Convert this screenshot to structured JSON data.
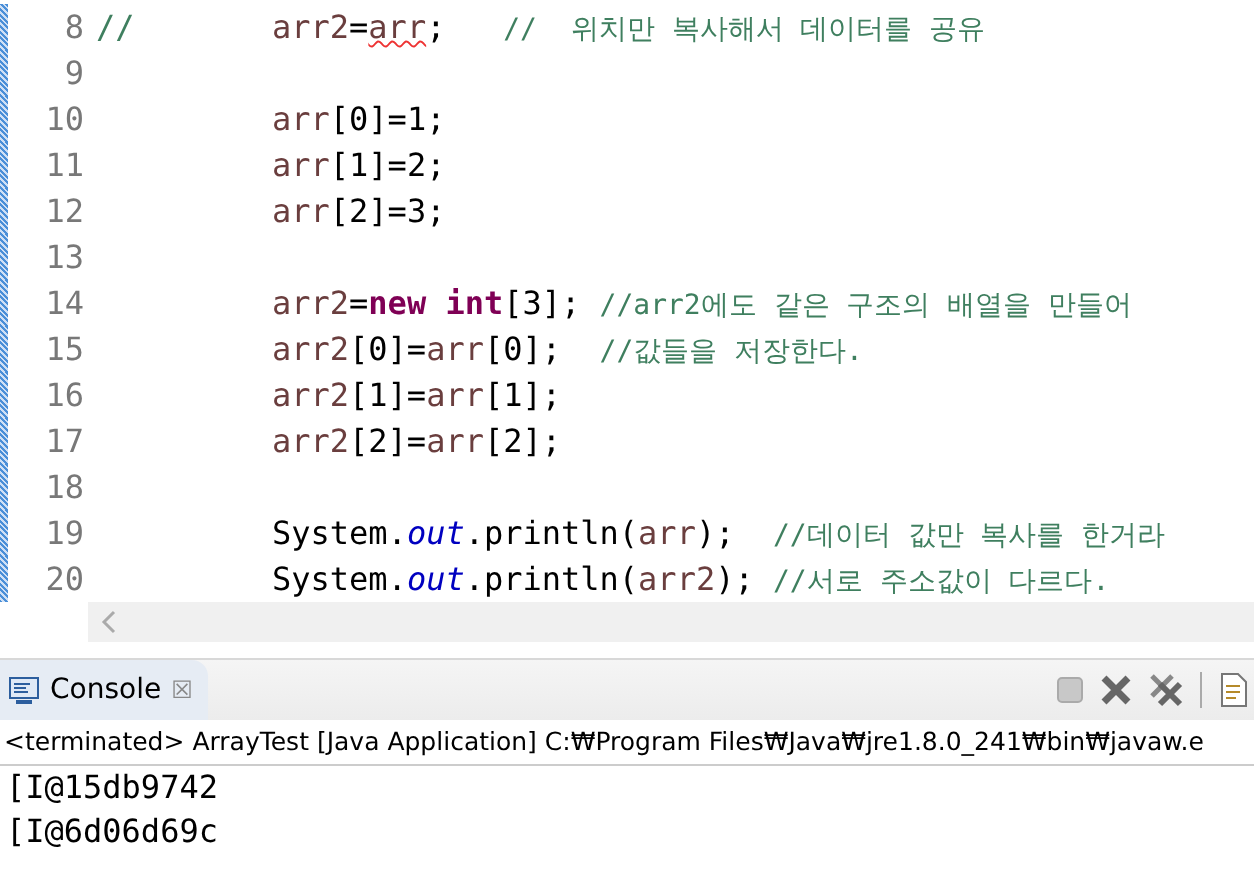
{
  "editor": {
    "lines": [
      {
        "number": "8",
        "commented_prefix": "//",
        "tokens": [
          {
            "kind": "var",
            "text": "arr2"
          },
          {
            "kind": "plain",
            "text": "="
          },
          {
            "kind": "var",
            "text": "arr",
            "squiggle": true
          },
          {
            "kind": "plain",
            "text": ";   "
          },
          {
            "kind": "comment",
            "text": "//  위치만 복사해서 데이터를 공유"
          }
        ]
      },
      {
        "number": "9"
      },
      {
        "number": "10",
        "tokens": [
          {
            "kind": "var",
            "text": "arr"
          },
          {
            "kind": "plain",
            "text": "[0]=1;"
          }
        ]
      },
      {
        "number": "11",
        "tokens": [
          {
            "kind": "var",
            "text": "arr"
          },
          {
            "kind": "plain",
            "text": "[1]=2;"
          }
        ]
      },
      {
        "number": "12",
        "tokens": [
          {
            "kind": "var",
            "text": "arr"
          },
          {
            "kind": "plain",
            "text": "[2]=3;"
          }
        ]
      },
      {
        "number": "13"
      },
      {
        "number": "14",
        "tokens": [
          {
            "kind": "var",
            "text": "arr2"
          },
          {
            "kind": "plain",
            "text": "="
          },
          {
            "kind": "keyword",
            "text": "new "
          },
          {
            "kind": "keyword",
            "text": "int"
          },
          {
            "kind": "plain",
            "text": "[3]; "
          },
          {
            "kind": "comment",
            "text": "//arr2에도 같은 구조의 배열을 만들어"
          }
        ]
      },
      {
        "number": "15",
        "tokens": [
          {
            "kind": "var",
            "text": "arr2"
          },
          {
            "kind": "plain",
            "text": "[0]="
          },
          {
            "kind": "var",
            "text": "arr"
          },
          {
            "kind": "plain",
            "text": "[0];  "
          },
          {
            "kind": "comment",
            "text": "//값들을 저장한다."
          }
        ]
      },
      {
        "number": "16",
        "tokens": [
          {
            "kind": "var",
            "text": "arr2"
          },
          {
            "kind": "plain",
            "text": "[1]="
          },
          {
            "kind": "var",
            "text": "arr"
          },
          {
            "kind": "plain",
            "text": "[1];"
          }
        ]
      },
      {
        "number": "17",
        "tokens": [
          {
            "kind": "var",
            "text": "arr2"
          },
          {
            "kind": "plain",
            "text": "[2]="
          },
          {
            "kind": "var",
            "text": "arr"
          },
          {
            "kind": "plain",
            "text": "[2];"
          }
        ]
      },
      {
        "number": "18"
      },
      {
        "number": "19",
        "tokens": [
          {
            "kind": "plain",
            "text": "System."
          },
          {
            "kind": "field",
            "text": "out"
          },
          {
            "kind": "plain",
            "text": ".println("
          },
          {
            "kind": "var",
            "text": "arr"
          },
          {
            "kind": "plain",
            "text": ");  "
          },
          {
            "kind": "comment",
            "text": "//데이터 값만 복사를 한거라"
          }
        ]
      },
      {
        "number": "20",
        "tokens": [
          {
            "kind": "plain",
            "text": "System."
          },
          {
            "kind": "field",
            "text": "out"
          },
          {
            "kind": "plain",
            "text": ".println("
          },
          {
            "kind": "var",
            "text": "arr2"
          },
          {
            "kind": "plain",
            "text": "); "
          },
          {
            "kind": "comment",
            "text": "//서로 주소값이 다르다."
          }
        ]
      }
    ]
  },
  "console": {
    "tab": {
      "label": "Console",
      "close": "☒",
      "selected": true
    },
    "status": "<terminated> ArrayTest [Java Application] C:₩Program Files₩Java₩jre1.8.0_241₩bin₩javaw.e",
    "output": [
      "[I@15db9742",
      "[I@6d06d69c"
    ]
  }
}
